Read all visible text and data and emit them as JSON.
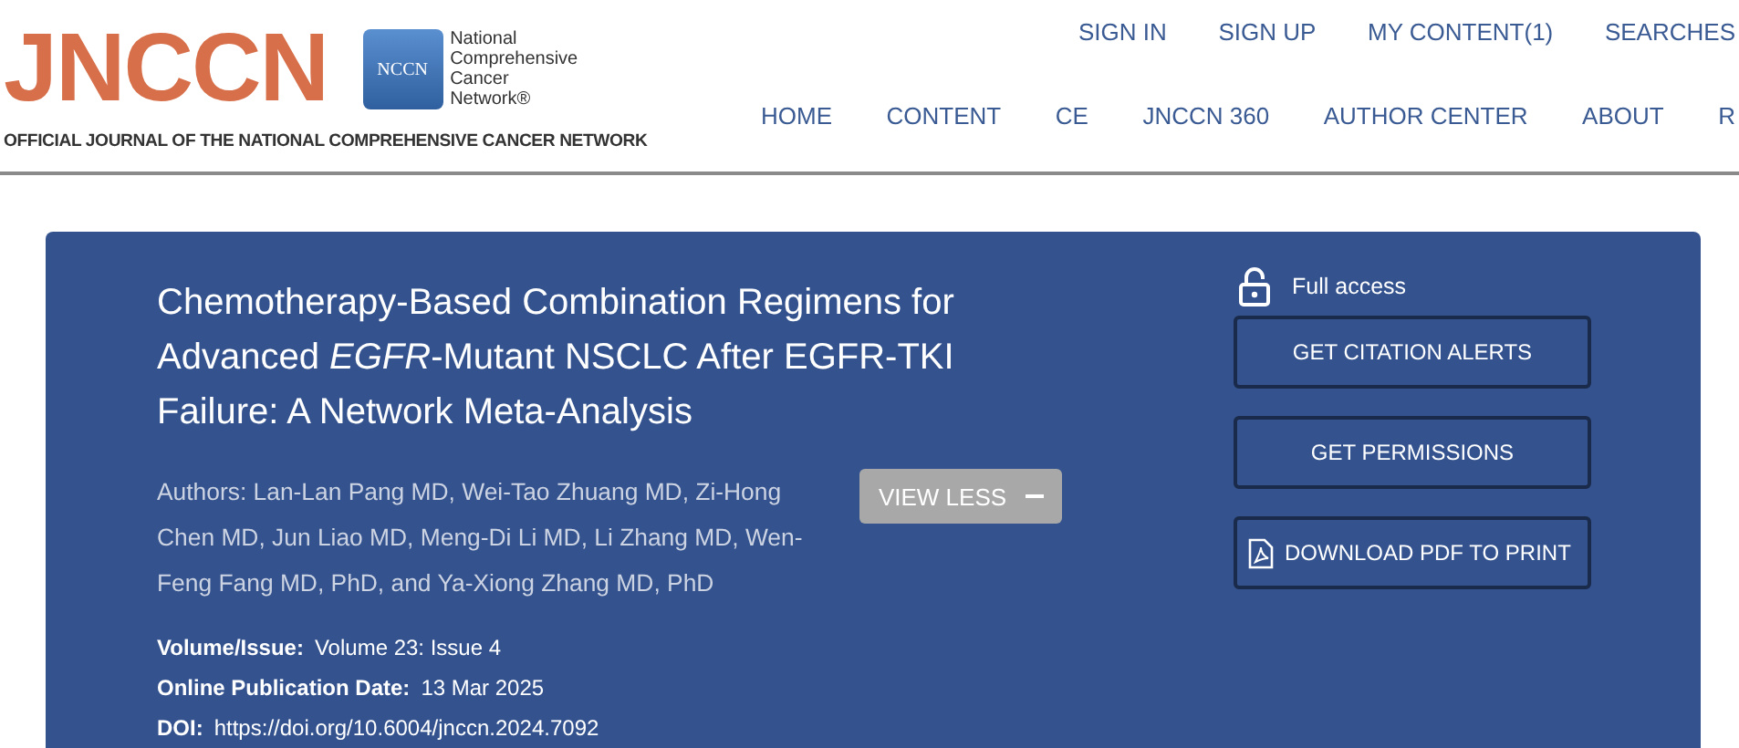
{
  "logo": {
    "wordmark": "JNCCN",
    "badge": "NCCN",
    "org_lines": [
      "National",
      "Comprehensive",
      "Cancer",
      "Network®"
    ],
    "tagline": "OFFICIAL JOURNAL OF THE NATIONAL COMPREHENSIVE CANCER NETWORK"
  },
  "utility_nav": [
    "SIGN IN",
    "SIGN UP",
    "MY CONTENT(1)",
    "SEARCHES"
  ],
  "main_nav": [
    "HOME",
    "CONTENT",
    "CE",
    "JNCCN 360",
    "AUTHOR CENTER",
    "ABOUT",
    "R"
  ],
  "article": {
    "title": "Chemotherapy-Based Combination Regimens for Advanced *EGFR*-Mutant NSCLC After EGFR-TKI Failure: A Network Meta-Analysis",
    "authors": "Authors: Lan-Lan Pang MD, Wei-Tao Zhuang MD, Zi-Hong Chen MD, Jun Liao MD, Meng-Di Li MD, Li Zhang MD, Wen-Feng Fang MD, PhD, and Ya-Xiong Zhang MD, PhD",
    "toggle": {
      "label": "VIEW LESS",
      "expanded": true
    },
    "meta": [
      {
        "label": "Volume/Issue:",
        "value": "Volume 23: Issue 4"
      },
      {
        "label": "Online Publication Date:",
        "value": "13 Mar 2025"
      },
      {
        "label": "DOI:",
        "value": "https://doi.org/10.6004/jnccn.2024.7092"
      }
    ],
    "access": "Full access",
    "actions": [
      {
        "label": "GET CITATION ALERTS",
        "kind": "plain"
      },
      {
        "label": "GET PERMISSIONS",
        "kind": "plain"
      },
      {
        "label": "DOWNLOAD PDF TO PRINT",
        "kind": "pdf"
      }
    ]
  }
}
